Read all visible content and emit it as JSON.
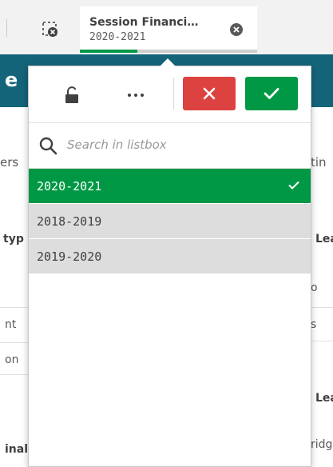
{
  "selection_bar": {
    "chip": {
      "title": "Session Financi…",
      "value": "2020-2021"
    }
  },
  "background": {
    "header_letter": "e",
    "left_fragments": [
      "ers",
      "typ",
      "nt",
      "on",
      "inal"
    ],
    "right_fragments": [
      "tin",
      "Lea",
      "o",
      "s",
      "Lea",
      "ridg"
    ]
  },
  "listbox": {
    "search": {
      "placeholder": "Search in listbox",
      "value": ""
    },
    "items": [
      {
        "label": "2020-2021",
        "state": "selected"
      },
      {
        "label": "2018-2019",
        "state": "alternative"
      },
      {
        "label": "2019-2020",
        "state": "alternative"
      }
    ]
  },
  "colors": {
    "selected": "#009845",
    "alternative": "#dddddd",
    "cancel": "#dc423f",
    "header": "#146479"
  },
  "icons": {
    "clear_all": "clear-selections-icon",
    "chip_close": "close-circle-icon",
    "lock": "unlock-icon",
    "more": "more-horizontal-icon",
    "cancel": "close-icon",
    "confirm": "check-icon",
    "search": "search-icon",
    "selected_item": "check-icon"
  }
}
